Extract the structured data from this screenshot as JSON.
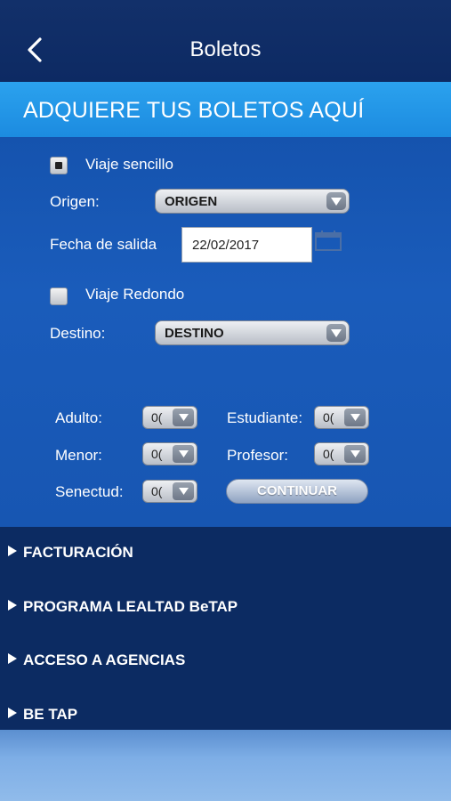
{
  "header": {
    "title": "Boletos"
  },
  "banner": {
    "text": "ADQUIERE TUS BOLETOS AQUÍ"
  },
  "form": {
    "single_trip_label": "Viaje sencillo",
    "single_trip_checked": true,
    "origin_label": "Origen:",
    "origin_value": "ORIGEN",
    "date_label": "Fecha de salida",
    "date_value": "22/02/2017",
    "round_trip_label": "Viaje Redondo",
    "round_trip_checked": false,
    "destination_label": "Destino:",
    "destination_value": "DESTINO"
  },
  "passengers": {
    "adult_label": "Adulto:",
    "adult_value": "0(",
    "student_label": "Estudiante:",
    "student_value": "0(",
    "minor_label": "Menor:",
    "minor_value": "0(",
    "teacher_label": "Profesor:",
    "teacher_value": "0(",
    "senior_label": "Senectud:",
    "senior_value": "0(",
    "continue_label": "CONTINUAR"
  },
  "menu": {
    "items": [
      {
        "label": "FACTURACIÓN"
      },
      {
        "label": "PROGRAMA LEALTAD BeTAP"
      },
      {
        "label": "ACCESO A AGENCIAS"
      },
      {
        "label": "BE TAP"
      }
    ]
  },
  "icons": {
    "back": "chevron-left-icon",
    "dropdown": "triangle-down-icon",
    "calendar": "calendar-icon",
    "menu_marker": "triangle-right-icon"
  },
  "colors": {
    "header": "#12306a",
    "banner": "#2ba2ee",
    "form": "#1a5cbb",
    "menu": "#0c2b62"
  }
}
